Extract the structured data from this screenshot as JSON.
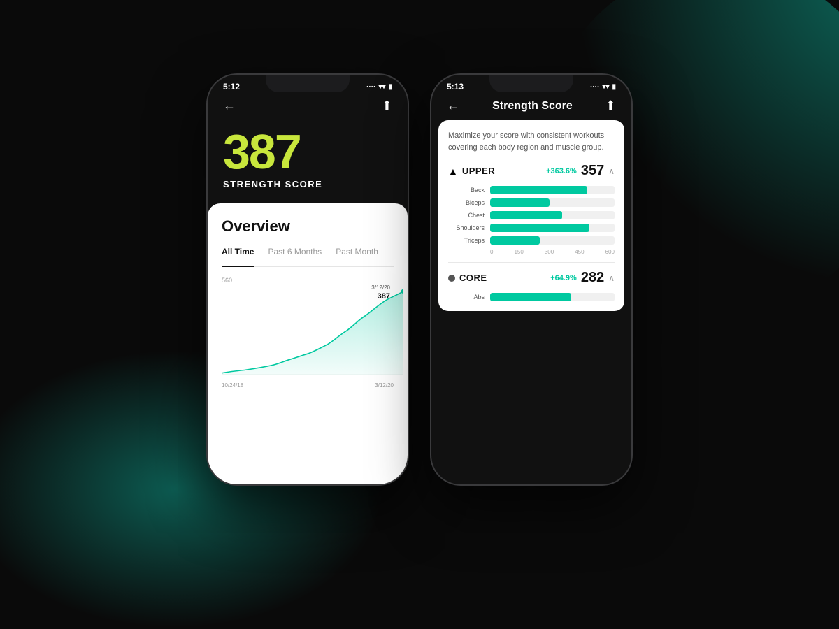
{
  "background": {
    "color": "#0a0a0a"
  },
  "phone1": {
    "status": {
      "time": "5:12",
      "wifi": "wifi",
      "battery": "battery"
    },
    "score": {
      "number": "387",
      "label": "STRENGTH SCORE"
    },
    "card": {
      "title": "Overview",
      "tabs": [
        {
          "label": "All Time",
          "active": true
        },
        {
          "label": "Past 6 Months",
          "active": false
        },
        {
          "label": "Past Month",
          "active": false
        }
      ],
      "chart": {
        "yMax": "560",
        "annotation": {
          "date": "3/12/20",
          "value": "387"
        },
        "xLabels": [
          "10/24/18",
          "3/12/20"
        ]
      }
    }
  },
  "phone2": {
    "status": {
      "time": "5:13",
      "wifi": "wifi",
      "battery": "battery"
    },
    "header": {
      "title": "Strength Score",
      "back": "←",
      "share": "share"
    },
    "description": "Maximize your score with consistent workouts covering each body region and muscle group.",
    "sections": [
      {
        "name": "UPPER",
        "icon": "▲",
        "change": "+363.6%",
        "score": "357",
        "bars": [
          {
            "label": "Back",
            "value": 78
          },
          {
            "label": "Biceps",
            "value": 48
          },
          {
            "label": "Chest",
            "value": 58
          },
          {
            "label": "Shoulders",
            "value": 80
          },
          {
            "label": "Triceps",
            "value": 40
          }
        ],
        "axisLabels": [
          "0",
          "150",
          "300",
          "450",
          "600"
        ]
      },
      {
        "name": "CORE",
        "icon": "●",
        "change": "+64.9%",
        "score": "282",
        "bars": [
          {
            "label": "Abs",
            "value": 65
          }
        ]
      }
    ]
  }
}
